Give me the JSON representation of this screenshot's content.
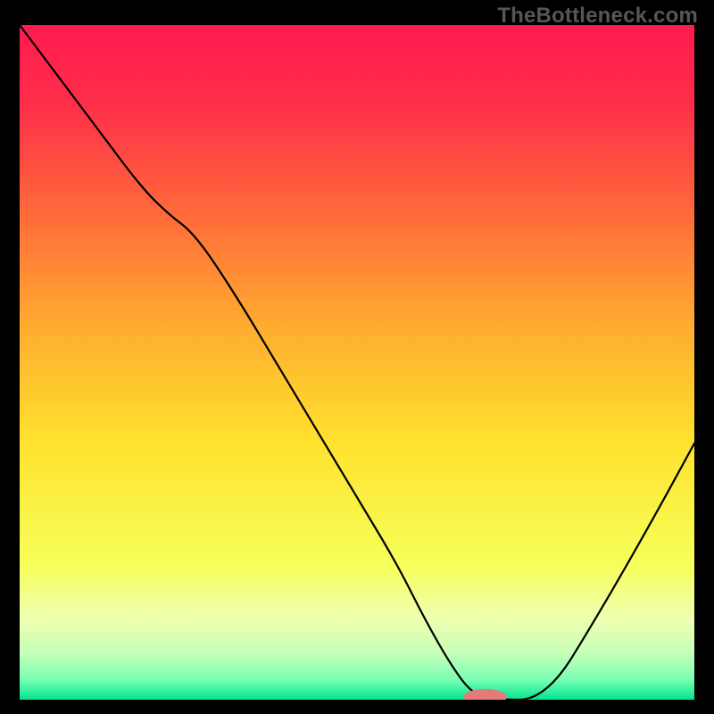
{
  "watermark": "TheBottleneck.com",
  "chart_data": {
    "type": "line",
    "title": "",
    "xlabel": "",
    "ylabel": "",
    "xlim": [
      0,
      100
    ],
    "ylim": [
      0,
      100
    ],
    "grid": false,
    "legend": null,
    "gradient_stops": [
      {
        "offset": 0,
        "color": "#ff1a4f"
      },
      {
        "offset": 12,
        "color": "#ff2f4a"
      },
      {
        "offset": 28,
        "color": "#ff6a3a"
      },
      {
        "offset": 45,
        "color": "#ffad2f"
      },
      {
        "offset": 62,
        "color": "#ffe22e"
      },
      {
        "offset": 80,
        "color": "#f6ff5a"
      },
      {
        "offset": 88,
        "color": "#eeffb0"
      },
      {
        "offset": 93,
        "color": "#c7ffb8"
      },
      {
        "offset": 97,
        "color": "#7affb4"
      },
      {
        "offset": 100,
        "color": "#00e58e"
      }
    ],
    "series": [
      {
        "name": "bottleneck-curve",
        "stroke": "#000000",
        "x": [
          0,
          6,
          12,
          18,
          22,
          26,
          32,
          38,
          44,
          50,
          56,
          60,
          64,
          67,
          70,
          78,
          86,
          94,
          100
        ],
        "y": [
          100,
          92,
          84,
          76,
          72,
          69,
          60,
          50,
          40,
          30,
          20,
          12,
          5,
          1,
          0,
          0,
          13,
          27,
          38
        ]
      }
    ],
    "markers": [
      {
        "name": "optimal-marker",
        "x": 69,
        "y": 0.4,
        "rx": 3.2,
        "ry": 1.2,
        "fill": "#e47a7a"
      }
    ]
  }
}
